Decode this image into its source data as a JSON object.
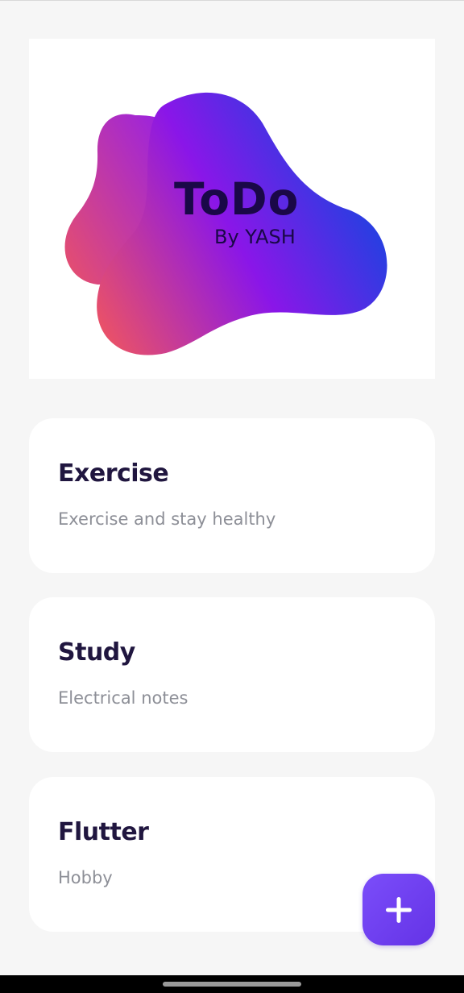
{
  "logo": {
    "title": "ToDo",
    "subtitle": "By YASH"
  },
  "tasks": [
    {
      "title": "Exercise",
      "description": "Exercise and stay healthy"
    },
    {
      "title": "Study",
      "description": "Electrical notes"
    },
    {
      "title": "Flutter",
      "description": "Hobby"
    }
  ],
  "fab": {
    "icon": "plus-icon"
  },
  "colors": {
    "background": "#f6f6f6",
    "card": "#ffffff",
    "title_text": "#20163f",
    "description_text": "#8d8f97",
    "accent": "#7b4dfa",
    "blob_gradient": [
      "#e8506a",
      "#8a16e8",
      "#1048e0"
    ]
  }
}
